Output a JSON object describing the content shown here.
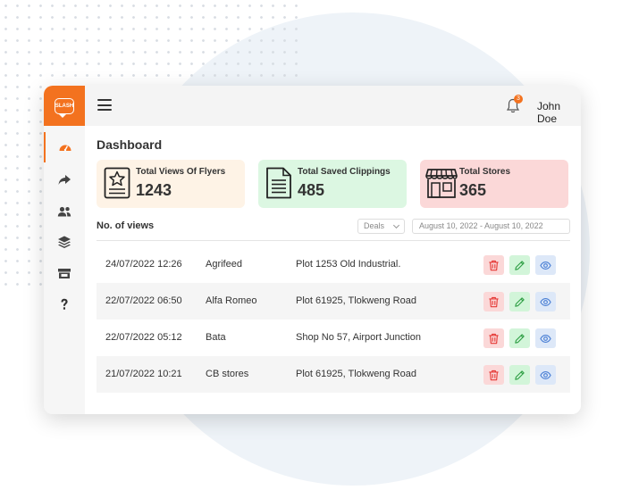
{
  "app": {
    "logo_text": "SLASH"
  },
  "header": {
    "user_name": "John Doe",
    "notification_count": "3"
  },
  "sidebar": {
    "items": [
      {
        "icon": "gauge-icon",
        "active": true
      },
      {
        "icon": "share-arrow-icon"
      },
      {
        "icon": "users-icon"
      },
      {
        "icon": "layers-icon"
      },
      {
        "icon": "store-icon"
      },
      {
        "icon": "question-icon"
      }
    ]
  },
  "dashboard": {
    "title": "Dashboard",
    "cards": [
      {
        "label": "Total Views Of Flyers",
        "value": "1243",
        "icon": "flyer-star-icon"
      },
      {
        "label": "Total Saved Clippings",
        "value": "485",
        "icon": "document-icon"
      },
      {
        "label": "Total Stores",
        "value": "365",
        "icon": "storefront-icon"
      }
    ]
  },
  "views": {
    "title": "No. of views",
    "filter_selected": "Deals",
    "date_range": "August 10, 2022 - August 10, 2022",
    "rows": [
      {
        "datetime": "24/07/2022 12:26",
        "name": "Agrifeed",
        "address": "Plot 1253 Old Industrial."
      },
      {
        "datetime": "22/07/2022 06:50",
        "name": "Alfa Romeo",
        "address": "Plot 61925, Tlokweng Road"
      },
      {
        "datetime": "22/07/2022 05:12",
        "name": "Bata",
        "address": "Shop No 57, Airport Junction"
      },
      {
        "datetime": "21/07/2022 10:21",
        "name": "CB stores",
        "address": "Plot 61925, Tlokweng Road"
      }
    ]
  },
  "colors": {
    "accent": "#f3721f",
    "delete": "#e53935",
    "edit": "#2e9e44",
    "view": "#4a7fd4"
  }
}
